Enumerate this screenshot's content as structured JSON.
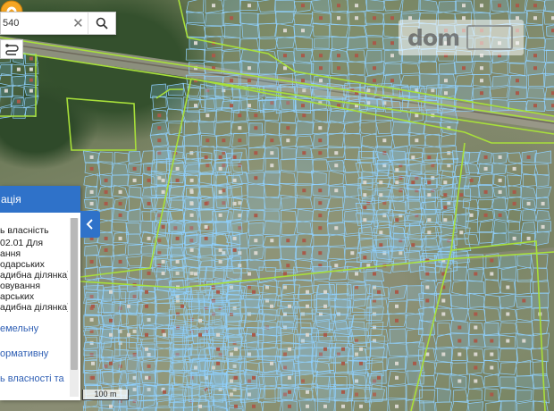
{
  "search": {
    "value": "540",
    "clear_glyph": "✕",
    "search_icon": "search-icon"
  },
  "route_icon": "route-icon",
  "watermark": {
    "text": "dom",
    "logo": "ria-logo"
  },
  "info_panel": {
    "title": "ація",
    "lines": [
      "ь власність",
      "02.01 Для",
      "ання",
      "одарських",
      "адибна ділянка)",
      "овування",
      "арських",
      "адибна ділянка)"
    ],
    "links": [
      "емельну",
      "ормативну",
      "ь власності та"
    ],
    "collapse_icon": "chevron-left-icon"
  },
  "scale": {
    "label": "100 m"
  },
  "marker": {
    "icon": "location-pin-icon",
    "color": "#f5a623"
  },
  "colors": {
    "parcel_outline": "#8fd0ff",
    "boundary_line": "#a8e03a",
    "panel_header": "#2f72c9"
  }
}
